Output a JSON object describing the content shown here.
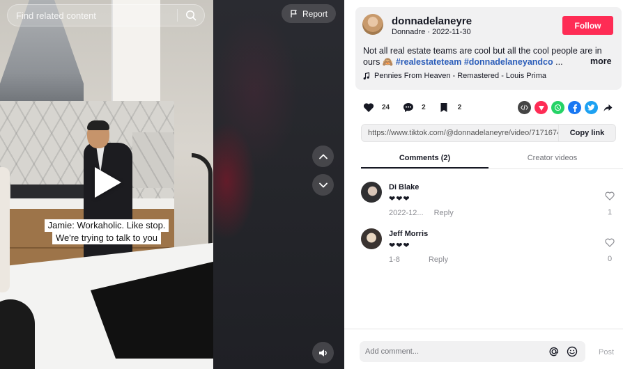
{
  "search": {
    "placeholder": "Find related content"
  },
  "video": {
    "report_label": "Report",
    "caption_line1": "Jamie: Workaholic. Like stop.",
    "caption_line2": "We're trying to talk to you"
  },
  "author": {
    "username": "donnadelaneyre",
    "nickname": "Donnadre",
    "date": "2022-11-30",
    "follow_label": "Follow"
  },
  "description": {
    "text": "Not all real estate teams are cool but all the cool people are in ours 🙈 ",
    "tag1": "#realestateteam",
    "tag2": "#donnadelaneyandco",
    "ellipsis": "...",
    "more_label": "more"
  },
  "music": {
    "title": "Pennies From Heaven - Remastered - Louis Prima"
  },
  "stats": {
    "likes": "24",
    "comments": "2",
    "saves": "2"
  },
  "share_icons": [
    "embed-icon",
    "send-icon",
    "whatsapp-icon",
    "facebook-icon",
    "twitter-icon",
    "share-arrow-icon"
  ],
  "link": {
    "url": "https://www.tiktok.com/@donnadelaneyre/video/7171674...",
    "copy_label": "Copy link"
  },
  "tabs": [
    {
      "label": "Comments (2)",
      "active": true
    },
    {
      "label": "Creator videos",
      "active": false
    }
  ],
  "comments": [
    {
      "name": "Di Blake",
      "text": "❤❤❤",
      "date": "2022-12...",
      "reply": "Reply",
      "likes": "1"
    },
    {
      "name": "Jeff Morris",
      "text": "❤❤❤",
      "date": "1-8",
      "reply": "Reply",
      "likes": "0"
    }
  ],
  "composer": {
    "placeholder": "Add comment...",
    "post_label": "Post"
  },
  "colors": {
    "follow": "#fe2c55",
    "hashtag": "#2b5db9",
    "whatsapp": "#25d366",
    "facebook": "#1877f2",
    "twitter": "#1da1f2"
  }
}
